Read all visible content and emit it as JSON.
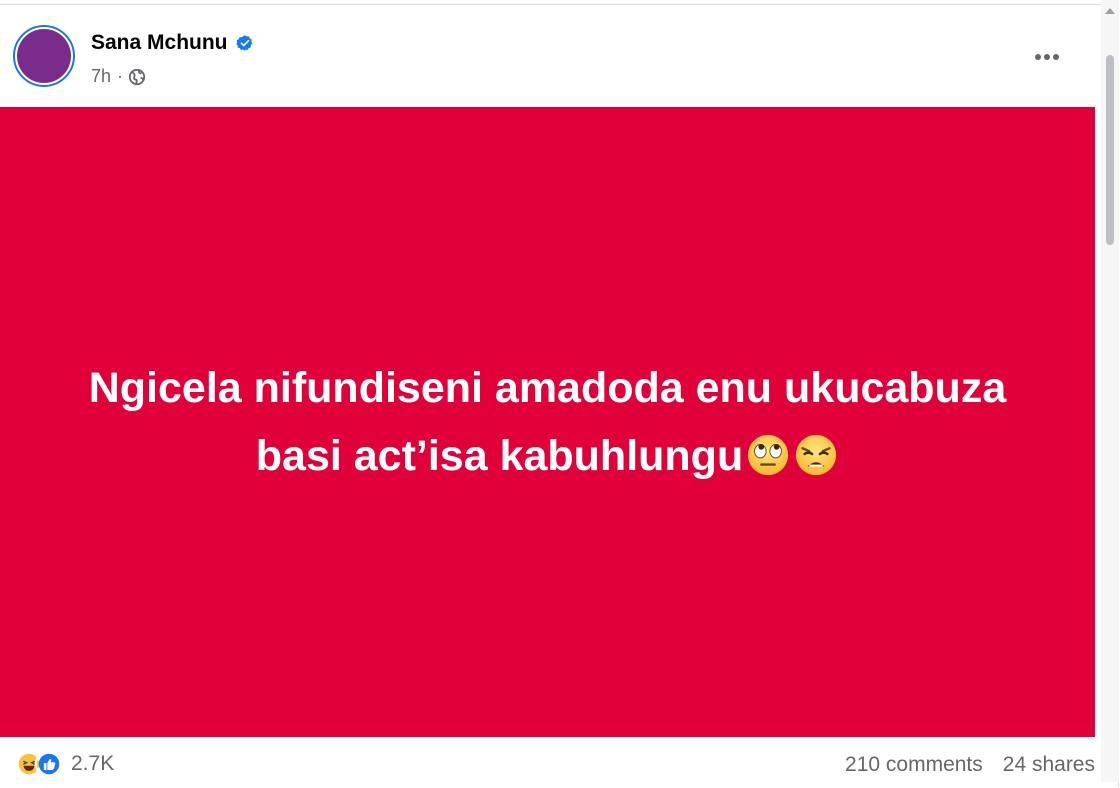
{
  "post": {
    "author": "Sana Mchunu",
    "time": "7h",
    "separator": "·",
    "text_line1": "Ngicela nifundiseni amadoda enu ukucabuza",
    "text_line2": "basi act’isa kabuhlungu",
    "background_color": "#e0003a"
  },
  "icons": {
    "verified": "verified-badge-icon",
    "audience": "globe-icon",
    "more": "more-options-icon",
    "emoji1": "face-with-rolling-eyes-emoji",
    "emoji2": "weary-face-emoji",
    "reaction1": "haha-reaction-icon",
    "reaction2": "like-reaction-icon"
  },
  "footer": {
    "reaction_count": "2.7K",
    "comments": "210 comments",
    "shares": "24 shares"
  },
  "colors": {
    "accent": "#1877f2",
    "avatar": "#7a2c8c",
    "secondary_text": "#65676b"
  }
}
